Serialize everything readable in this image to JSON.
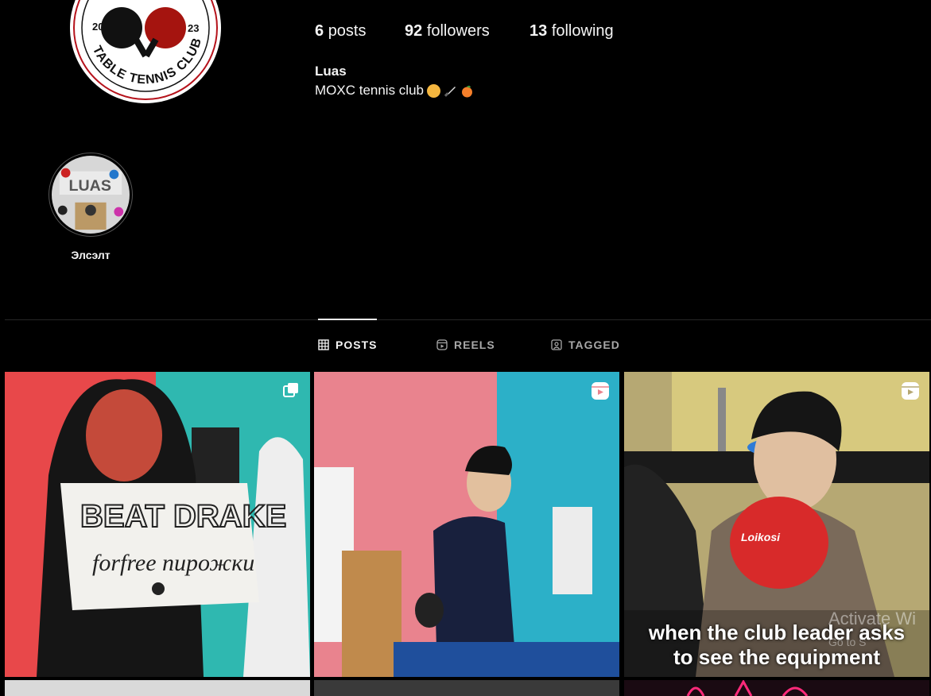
{
  "profile": {
    "logo_text_year_left": "20",
    "logo_text_year_right": "23",
    "logo_text_club": "TABLE TENNIS CLUB",
    "stats": {
      "posts_count": "6",
      "posts_label": "posts",
      "followers_count": "92",
      "followers_label": "followers",
      "following_count": "13",
      "following_label": "following"
    },
    "username": "Luas",
    "bio": "MOXC tennis club"
  },
  "highlights": [
    {
      "label": "Элсэлт"
    }
  ],
  "tabs": [
    {
      "label": "POSTS",
      "icon": "grid-icon",
      "active": true
    },
    {
      "label": "REELS",
      "icon": "reels-icon",
      "active": false
    },
    {
      "label": "TAGGED",
      "icon": "tagged-icon",
      "active": false
    }
  ],
  "posts": [
    {
      "type": "carousel",
      "icon": "carousel-icon",
      "sign_line1": "BEAT DRAKE",
      "sign_line2": "forfree пирожки"
    },
    {
      "type": "reel",
      "icon": "reels-icon"
    },
    {
      "type": "reel",
      "icon": "reels-icon",
      "caption_line1": "when the club leader asks",
      "caption_line2": "to see the equipment"
    }
  ],
  "watermark": {
    "line1": "Activate Wi",
    "line2": "Go to S"
  },
  "colors": {
    "background": "#000000",
    "text": "#f5f5f5",
    "muted": "#a8a8a8",
    "divider": "#262626"
  }
}
